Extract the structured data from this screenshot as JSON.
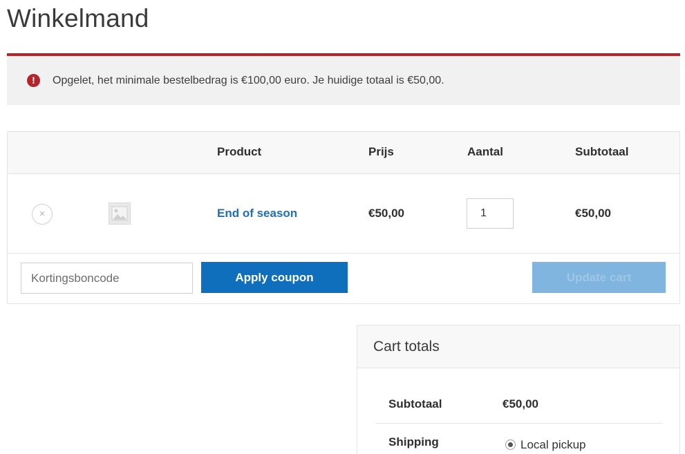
{
  "page": {
    "title": "Winkelmand"
  },
  "notice": {
    "icon": "exclamation-icon",
    "color": "#b3252b",
    "text": "Opgelet, het minimale bestelbedrag is €100,00 euro. Je huidige totaal is €50,00."
  },
  "cart": {
    "columns": [
      "",
      "",
      "Product",
      "Prijs",
      "Aantal",
      "Subtotaal"
    ],
    "items": [
      {
        "remove_icon": "close-icon",
        "thumbnail_icon": "image-placeholder-icon",
        "product": "End of season",
        "price": "€50,00",
        "quantity": "1",
        "subtotal": "€50,00"
      }
    ],
    "coupon_placeholder": "Kortingsboncode",
    "apply_label": "Apply coupon",
    "update_label": "Update cart"
  },
  "totals": {
    "title": "Cart totals",
    "subtotal_label": "Subtotaal",
    "subtotal_value": "€50,00",
    "shipping_label": "Shipping",
    "shipping_option": "Local pickup"
  },
  "colors": {
    "accent": "#0f6fbd",
    "link": "#1e6fb5",
    "error": "#b3252b",
    "update_disabled": "#7fb5df"
  }
}
